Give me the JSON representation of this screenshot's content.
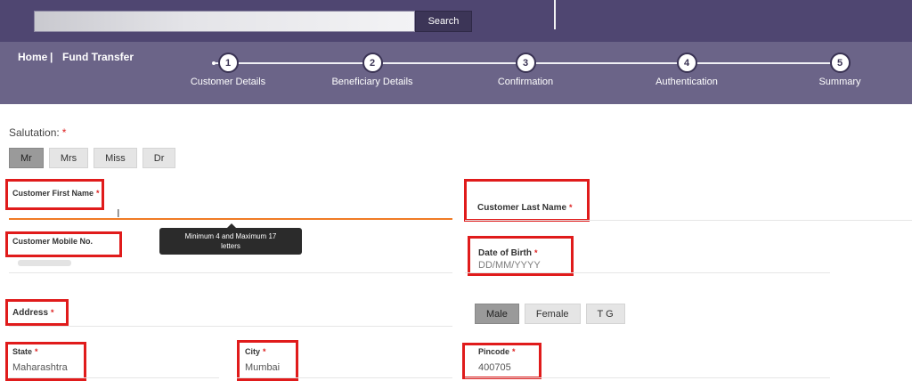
{
  "header": {
    "search_placeholder": "",
    "search_button": "Search"
  },
  "breadcrumb": {
    "home": "Home",
    "separator": "|",
    "current": "Fund Transfer"
  },
  "steps": [
    {
      "number": "1",
      "label": "Customer Details"
    },
    {
      "number": "2",
      "label": "Beneficiary Details"
    },
    {
      "number": "3",
      "label": "Confirmation"
    },
    {
      "number": "4",
      "label": "Authentication"
    },
    {
      "number": "5",
      "label": "Summary"
    }
  ],
  "form": {
    "salutation_label": "Salutation:",
    "required_mark": "*",
    "salutations": [
      "Mr",
      "Mrs",
      "Miss",
      "Dr"
    ],
    "selected_salutation": "Mr",
    "first_name_label": "Customer First Name",
    "first_name_value": "",
    "last_name_label": "Customer Last Name",
    "mobile_label": "Customer Mobile No.",
    "dob_label": "Date of Birth",
    "dob_placeholder": "DD/MM/YYYY",
    "address_label": "Address",
    "genders": [
      "Male",
      "Female",
      "T G"
    ],
    "selected_gender": "Male",
    "state_label": "State",
    "state_value": "Maharashtra",
    "city_label": "City",
    "city_value": "Mumbai",
    "pincode_label": "Pincode",
    "pincode_value": "400705"
  },
  "tooltip": {
    "line1": "Minimum 4 and Maximum 17",
    "line2": "letters"
  },
  "colors": {
    "header_bg": "#4f4671",
    "stepbar_bg": "#6b6488",
    "highlight_box": "#e01b1b",
    "focus_underline": "#f07b26"
  }
}
